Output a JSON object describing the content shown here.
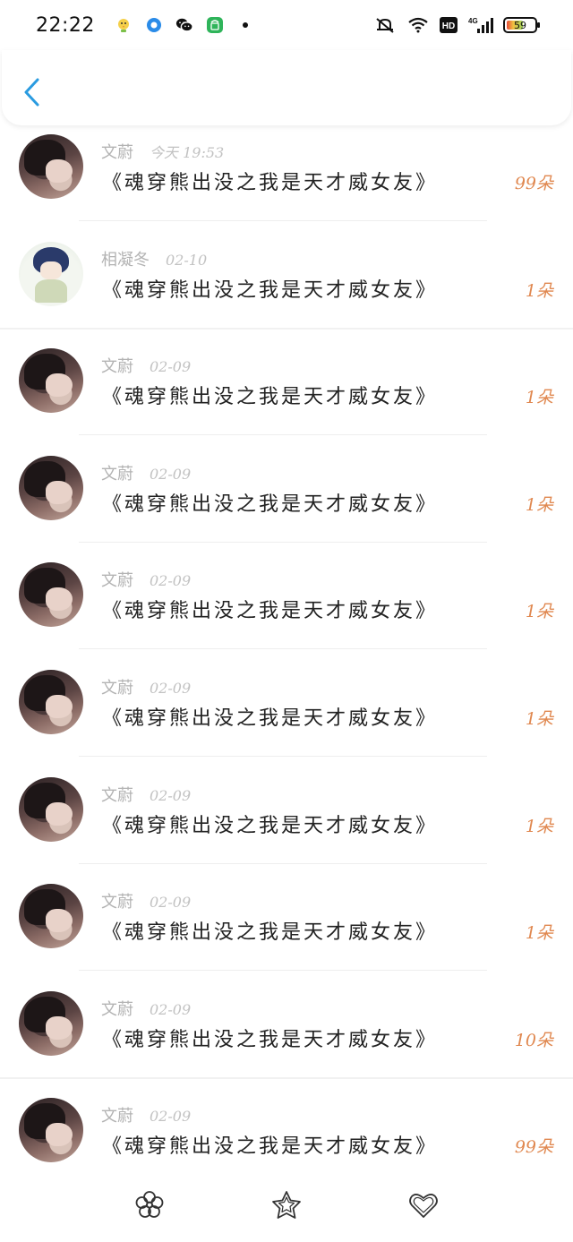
{
  "status_bar": {
    "time": "22:22",
    "left_icons": [
      "chick-icon",
      "blue-dot-app-icon",
      "wechat-icon",
      "green-shop-icon",
      "dot-icon"
    ],
    "right_icons": [
      "mute-bell-icon",
      "wifi-icon",
      "hd-icon",
      "signal-4g-icon"
    ],
    "hd_label": "HD",
    "net_label": "4G",
    "battery_level": "59",
    "battery_fraction": 0.59
  },
  "header": {
    "back_icon": "chevron-left-icon",
    "accent_color": "#2a9be0"
  },
  "colors": {
    "count": "#e08850",
    "meta": "#b3b3b3",
    "title": "#222222"
  },
  "items": [
    {
      "avatar": "dark",
      "name": "文蔚",
      "time": "今天 19:53",
      "title": "《魂穿熊出没之我是天才威女友》",
      "count": "99朵"
    },
    {
      "avatar": "anime",
      "name": "相凝冬",
      "time": "02-10",
      "title": "《魂穿熊出没之我是天才威女友》",
      "count": "1朵"
    },
    {
      "avatar": "dark",
      "name": "文蔚",
      "time": "02-09",
      "title": "《魂穿熊出没之我是天才威女友》",
      "count": "1朵"
    },
    {
      "avatar": "dark",
      "name": "文蔚",
      "time": "02-09",
      "title": "《魂穿熊出没之我是天才威女友》",
      "count": "1朵"
    },
    {
      "avatar": "dark",
      "name": "文蔚",
      "time": "02-09",
      "title": "《魂穿熊出没之我是天才威女友》",
      "count": "1朵"
    },
    {
      "avatar": "dark",
      "name": "文蔚",
      "time": "02-09",
      "title": "《魂穿熊出没之我是天才威女友》",
      "count": "1朵"
    },
    {
      "avatar": "dark",
      "name": "文蔚",
      "time": "02-09",
      "title": "《魂穿熊出没之我是天才威女友》",
      "count": "1朵"
    },
    {
      "avatar": "dark",
      "name": "文蔚",
      "time": "02-09",
      "title": "《魂穿熊出没之我是天才威女友》",
      "count": "1朵"
    },
    {
      "avatar": "dark",
      "name": "文蔚",
      "time": "02-09",
      "title": "《魂穿熊出没之我是天才威女友》",
      "count": "10朵"
    },
    {
      "avatar": "dark",
      "name": "文蔚",
      "time": "02-09",
      "title": "《魂穿熊出没之我是天才威女友》",
      "count": "99朵"
    }
  ],
  "bottom_bar": {
    "icons": [
      "flower-icon",
      "star-icon",
      "heart-icon"
    ]
  }
}
